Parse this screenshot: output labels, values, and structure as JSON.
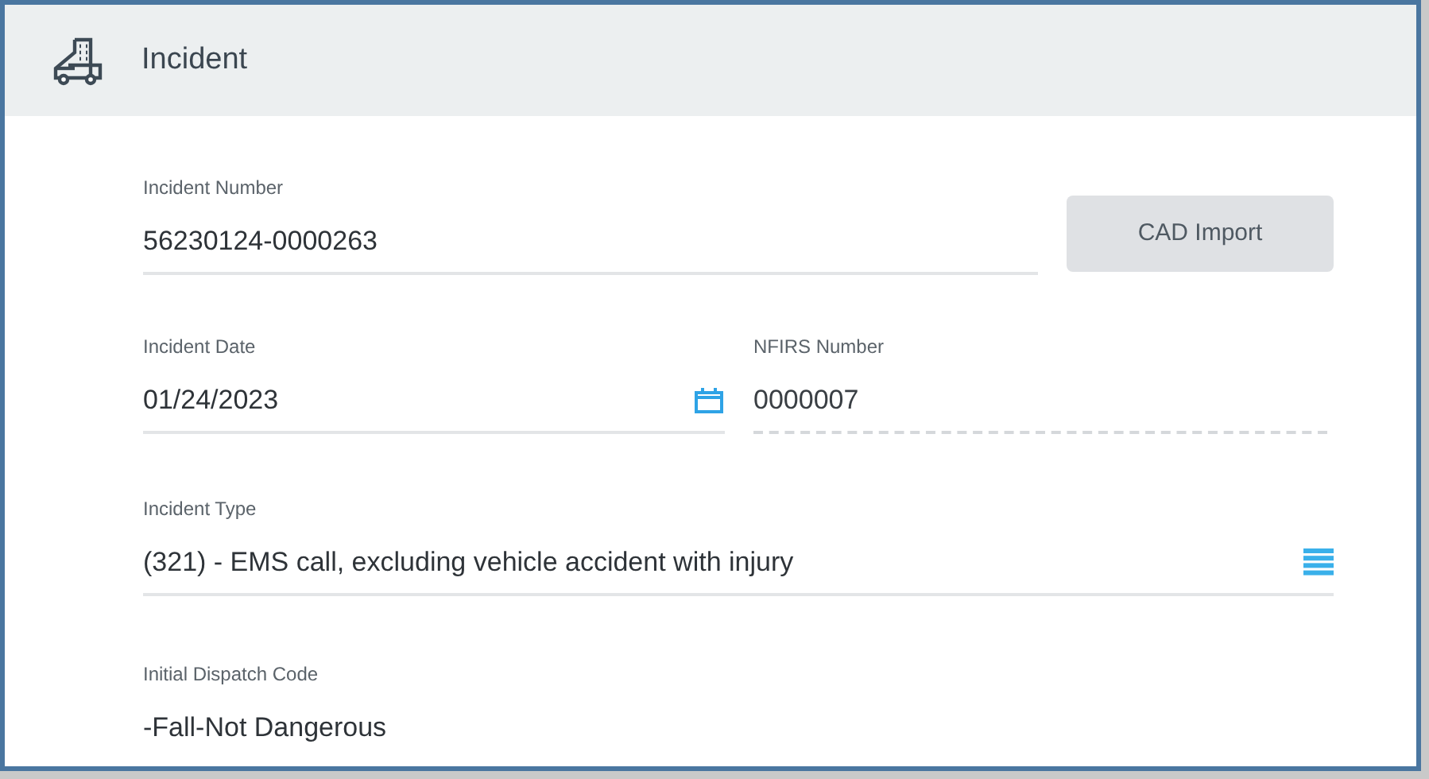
{
  "header": {
    "title": "Incident"
  },
  "incident_number": {
    "label": "Incident Number",
    "value": "56230124-0000263",
    "disabled": false
  },
  "cad_import_button": {
    "label": "CAD Import"
  },
  "incident_date": {
    "label": "Incident Date",
    "value": "01/24/2023",
    "disabled": false
  },
  "nfirs_number": {
    "label": "NFIRS Number",
    "value": "0000007",
    "disabled": true
  },
  "incident_type": {
    "label": "Incident Type",
    "value": "(321) - EMS call, excluding vehicle accident with injury",
    "disabled": false
  },
  "initial_dispatch_code": {
    "label": "Initial Dispatch Code",
    "value": "-Fall-Not Dangerous"
  }
}
